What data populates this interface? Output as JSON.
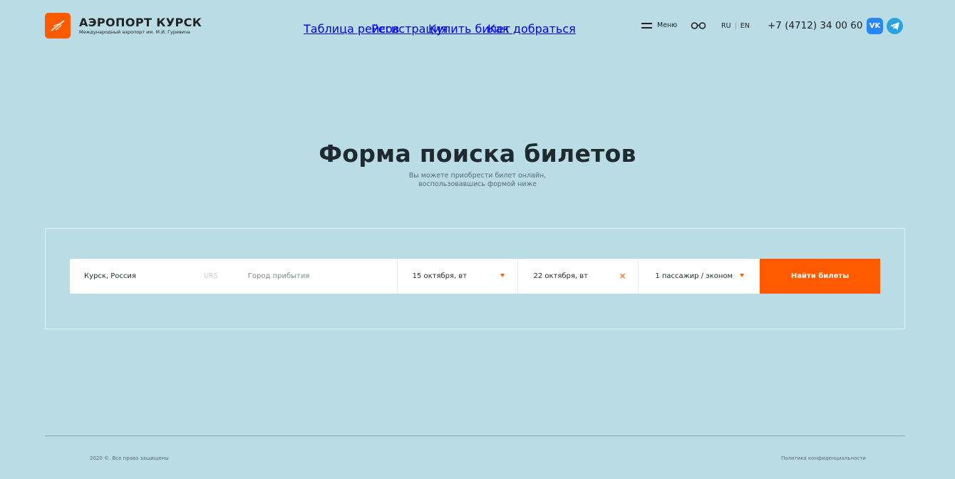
{
  "brand": {
    "title": "АЭРОПОРТ КУРСК",
    "subtitle": "Международный аэропорт им. М.И. Гуревича",
    "logo_icon": "plane-icon",
    "accent_color": "#ff5a00"
  },
  "nav": {
    "items": [
      {
        "label": "Таблица рейсов"
      },
      {
        "label": "Регистрация"
      },
      {
        "label": "Купить билет"
      },
      {
        "label": "Как добраться"
      }
    ],
    "menu_label": "Меню",
    "menu_icon": "hamburger-icon",
    "accessibility_icon": "glasses-icon",
    "lang_ru": "RU",
    "lang_sep": "|",
    "lang_en": "EN",
    "phone": "+7 (4712) 34 00 60",
    "vk_label": "VK",
    "vk_icon": "vk-icon",
    "telegram_icon": "telegram-icon"
  },
  "hero": {
    "title": "Форма поиска билетов",
    "subtitle_line1": "Вы можете приобрести билет онлайн,",
    "subtitle_line2": "воспользовавшись формой ниже"
  },
  "search": {
    "from_value": "Курск, Россия",
    "from_code": "URS",
    "to_placeholder": "Город прибытия",
    "depart_date": "15 октября, вт",
    "return_date": "22 октября, вт",
    "passengers": "1 пассажир / эконом",
    "submit_label": "Найти билеты"
  },
  "footer": {
    "copyright": "2020 ©. Все права защищены",
    "privacy": "Политика конфиденциальности"
  }
}
